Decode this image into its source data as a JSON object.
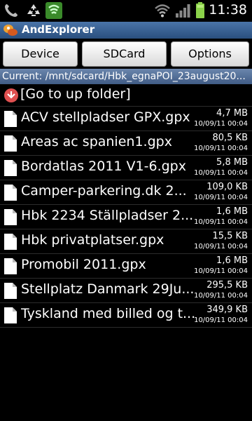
{
  "status": {
    "time": "11:38",
    "icons": [
      "viber-icon",
      "recycle-icon",
      "shield-icon",
      "wifi-icon",
      "signal-icon",
      "battery-icon"
    ]
  },
  "app": {
    "title": "AndExplorer"
  },
  "buttons": {
    "device": "Device",
    "sdcard": "SDCard",
    "options": "Options"
  },
  "path": "Current: /mnt/sdcard/Hbk_egnaPOI_23august20...",
  "up_folder": "[Go to up folder]",
  "files": [
    {
      "name": "ACV stellpladser GPX.gpx",
      "size": "4,7 MB",
      "date": "10/09/11 00:04"
    },
    {
      "name": "Areas ac spanien1.gpx",
      "size": "80,5 KB",
      "date": "10/09/11 00:04"
    },
    {
      "name": "Bordatlas 2011 V1-6.gpx",
      "size": "5,8 MB",
      "date": "10/09/11 00:04"
    },
    {
      "name": "Camper-parkering.dk 2...",
      "size": "109,0 KB",
      "date": "10/09/11 00:04"
    },
    {
      "name": "Hbk 2234 Ställpladser 2...",
      "size": "1,6 MB",
      "date": "10/09/11 00:04"
    },
    {
      "name": "Hbk privatplatser.gpx",
      "size": "15,5 KB",
      "date": "10/09/11 00:04"
    },
    {
      "name": "Promobil 2011.gpx",
      "size": "1,6 MB",
      "date": "10/09/11 00:04"
    },
    {
      "name": "Stellplatz Danmark 29Ju...",
      "size": "295,5 KB",
      "date": "10/09/11 00:04"
    },
    {
      "name": "Tyskland med billed og t...",
      "size": "349,9 KB",
      "date": "10/09/11 00:04"
    }
  ]
}
